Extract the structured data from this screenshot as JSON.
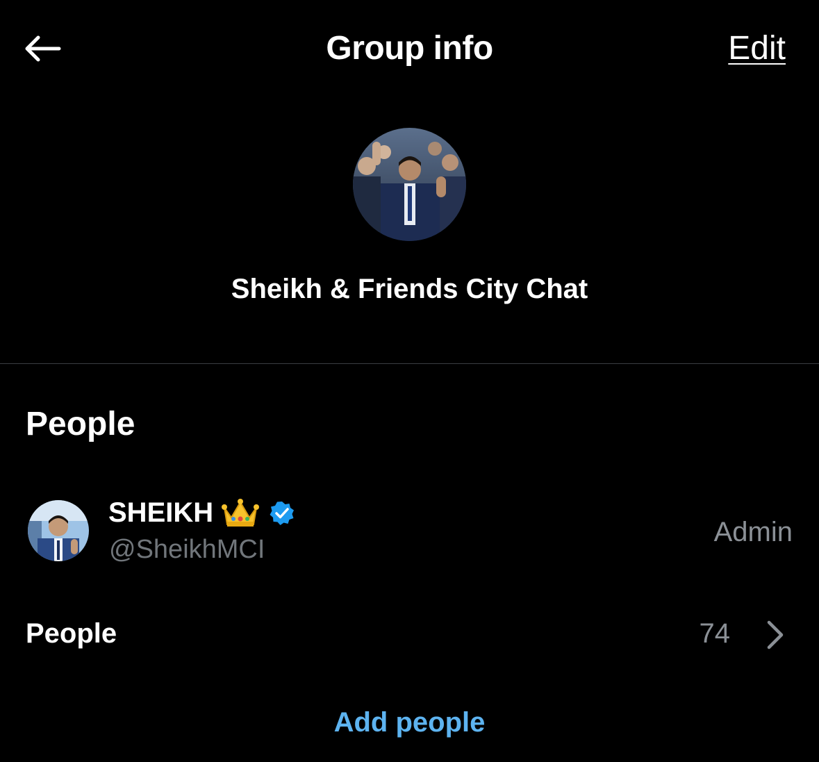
{
  "header": {
    "back_icon": "arrow-left-icon",
    "title": "Group info",
    "edit_label": "Edit"
  },
  "group": {
    "name": "Sheikh & Friends City Chat"
  },
  "people_section": {
    "title": "People",
    "members": [
      {
        "name": "SHEIKH",
        "emoji": "👑",
        "verified": true,
        "handle": "@SheikhMCI",
        "role": "Admin"
      }
    ],
    "people_label": "People",
    "people_count": "74",
    "add_people_label": "Add people"
  },
  "colors": {
    "background": "#000000",
    "accent": "#5db3f0",
    "muted_text": "#71767b",
    "verified_badge": "#1d9bf0"
  }
}
